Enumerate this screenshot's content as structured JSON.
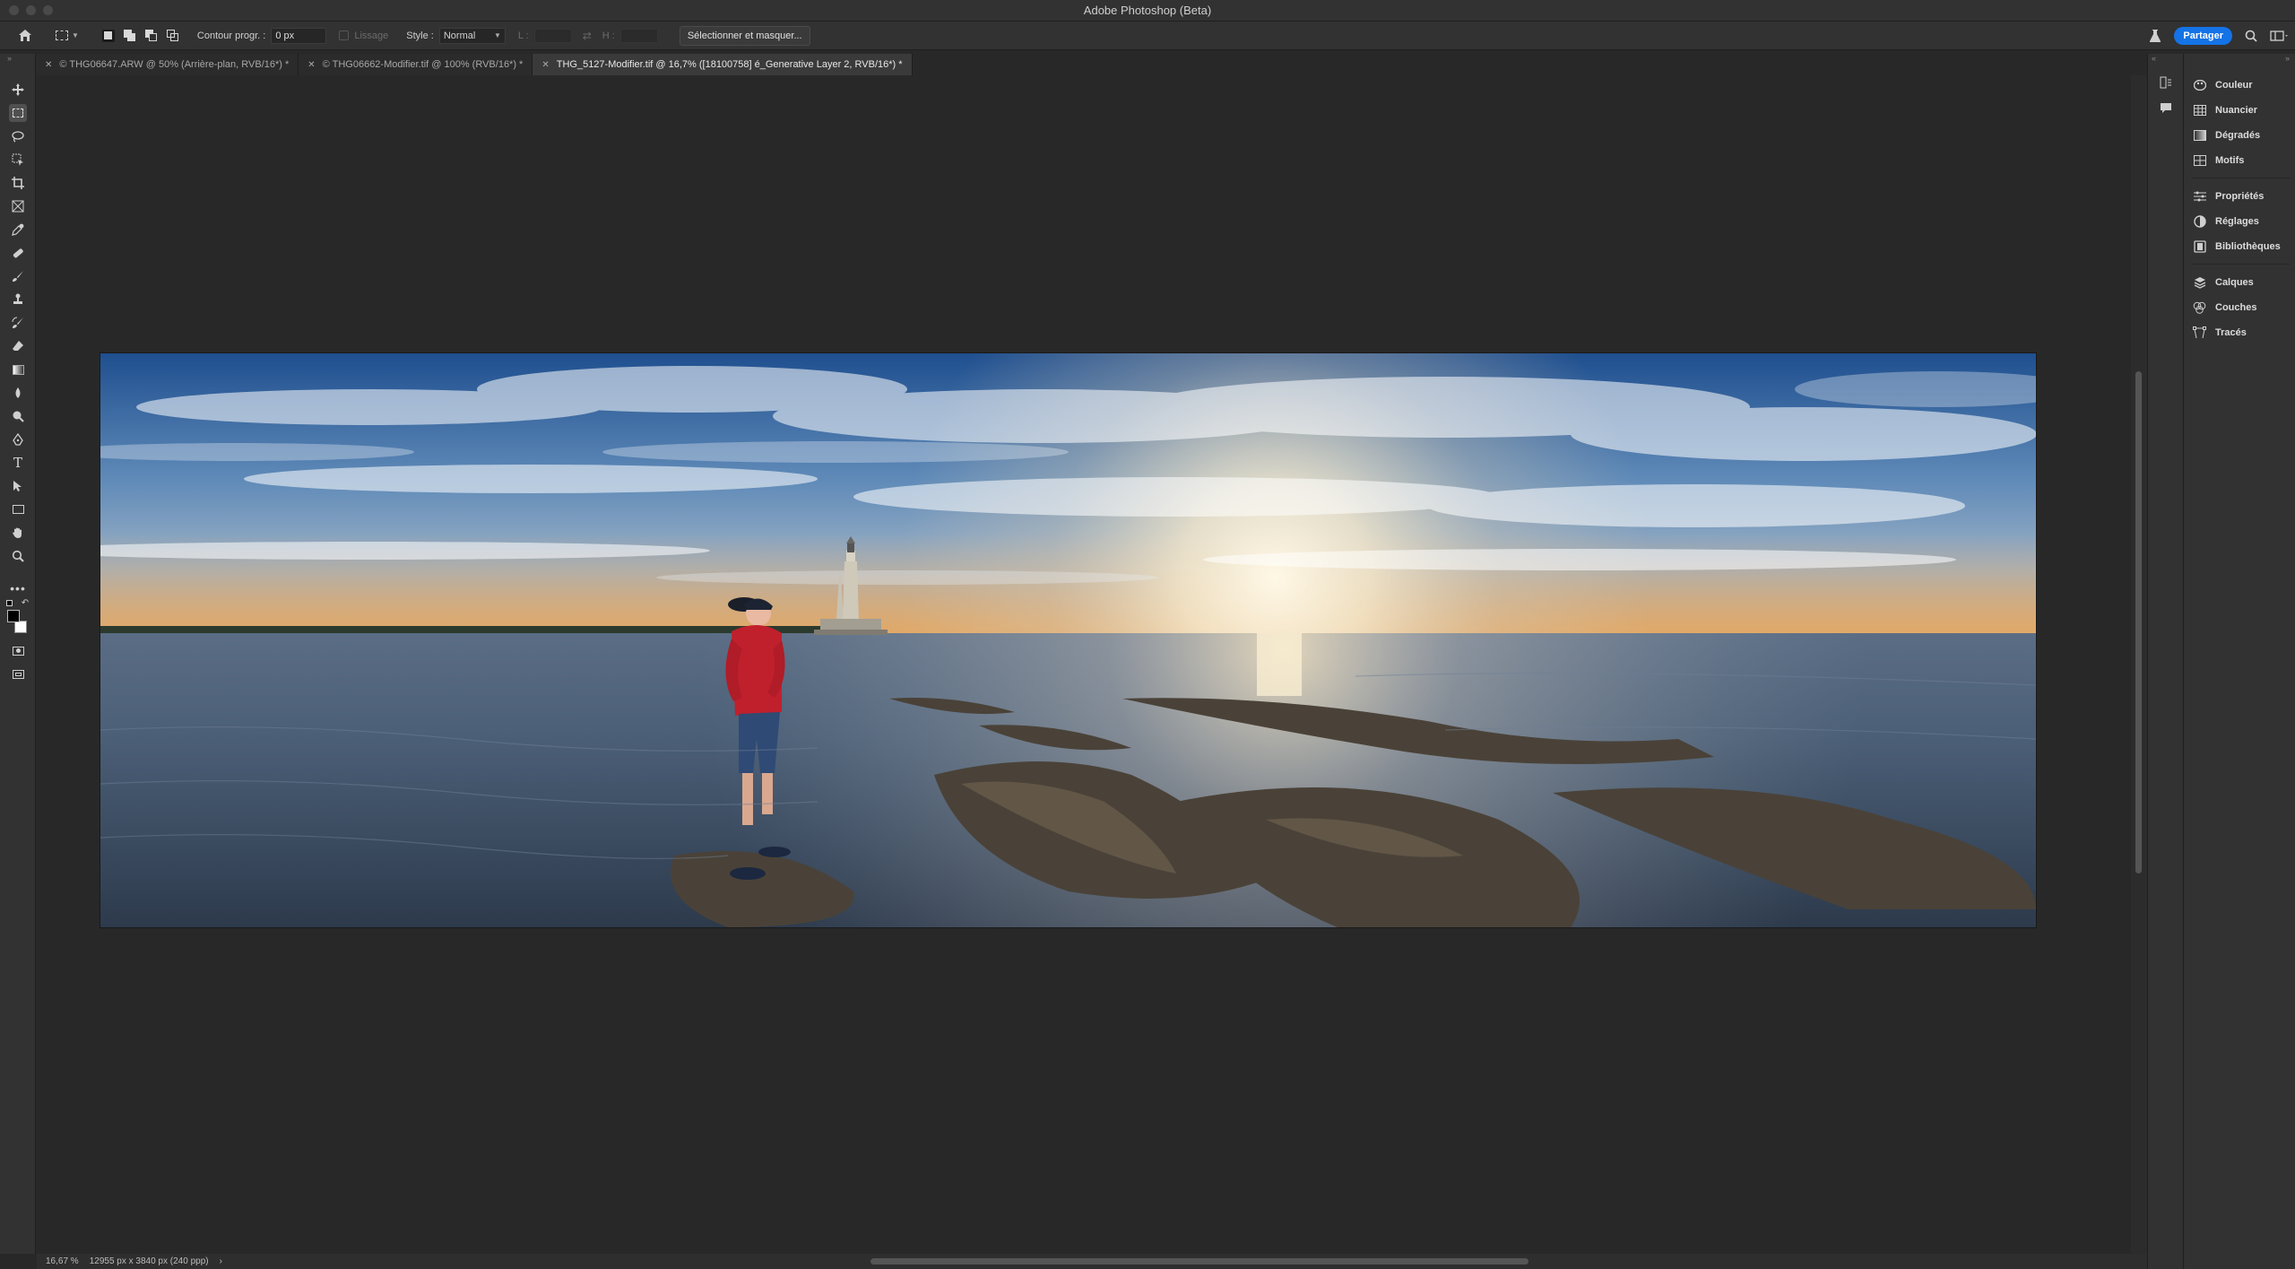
{
  "app": {
    "title": "Adobe Photoshop (Beta)"
  },
  "options": {
    "feather_label": "Contour progr. :",
    "feather_value": "0 px",
    "antialias_label": "Lissage",
    "style_label": "Style :",
    "style_value": "Normal",
    "width_label": "L :",
    "height_label": "H :",
    "select_mask_label": "Sélectionner et masquer...",
    "share_label": "Partager"
  },
  "tabs": [
    {
      "label": "© THG06647.ARW @ 50% (Arrière-plan, RVB/16*) *",
      "active": false
    },
    {
      "label": "© THG06662-Modifier.tif @ 100% (RVB/16*) *",
      "active": false
    },
    {
      "label": "THG_5127-Modifier.tif @ 16,7% ([18100758] é_Generative Layer 2, RVB/16*) *",
      "active": true
    }
  ],
  "tools": [
    "move-tool",
    "rectangular-marquee-tool",
    "lasso-tool",
    "object-selection-tool",
    "crop-tool",
    "frame-tool",
    "eyedropper-tool",
    "spot-healing-tool",
    "brush-tool",
    "clone-stamp-tool",
    "history-brush-tool",
    "eraser-tool",
    "gradient-tool",
    "blur-tool",
    "dodge-tool",
    "pen-tool",
    "type-tool",
    "path-selection-tool",
    "rectangle-tool",
    "hand-tool",
    "zoom-tool",
    "more-tools",
    "quick-mask",
    "screen-mode"
  ],
  "colors": {
    "foreground": "#000000",
    "background": "#ffffff",
    "accent": "#1473e6"
  },
  "panels": {
    "group1": [
      {
        "label": "Couleur",
        "icon": "color-palette-icon"
      },
      {
        "label": "Nuancier",
        "icon": "swatches-grid-icon"
      },
      {
        "label": "Dégradés",
        "icon": "gradient-icon"
      },
      {
        "label": "Motifs",
        "icon": "patterns-icon"
      }
    ],
    "group2": [
      {
        "label": "Propriétés",
        "icon": "properties-sliders-icon"
      },
      {
        "label": "Réglages",
        "icon": "adjustments-icon"
      },
      {
        "label": "Bibliothèques",
        "icon": "libraries-icon"
      }
    ],
    "group3": [
      {
        "label": "Calques",
        "icon": "layers-icon"
      },
      {
        "label": "Couches",
        "icon": "channels-icon"
      },
      {
        "label": "Tracés",
        "icon": "paths-icon"
      }
    ]
  },
  "status": {
    "zoom": "16,67 %",
    "doc_info": "12955 px x 3840 px (240 ppp)",
    "more": "›"
  }
}
